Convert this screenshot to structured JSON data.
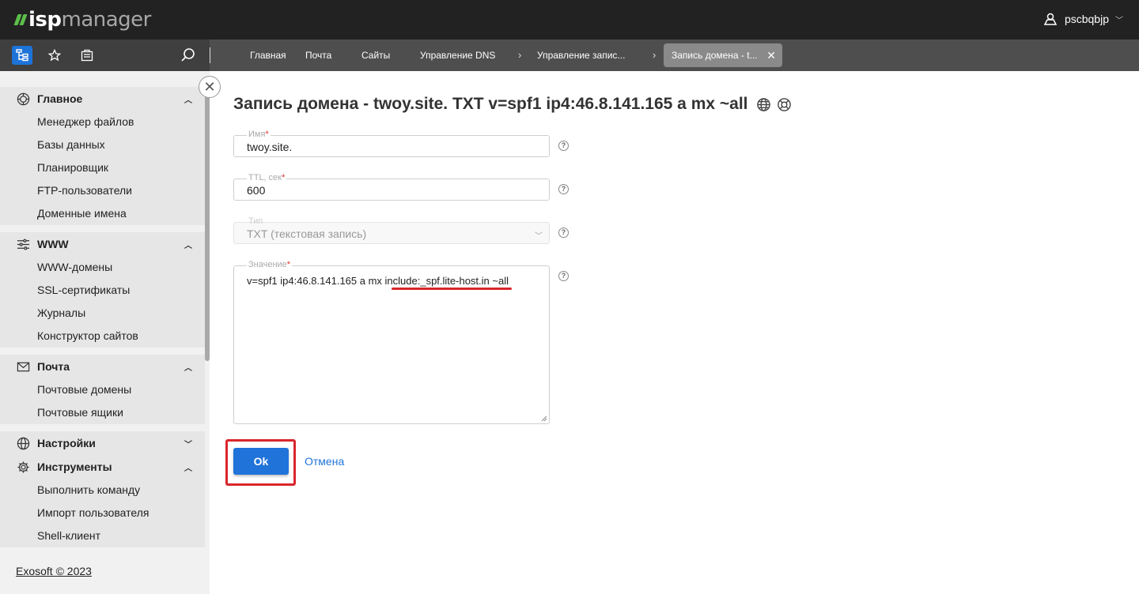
{
  "app": {
    "logo_part1": "isp",
    "logo_part2": "manager",
    "username": "pscbqbjp"
  },
  "tabs": [
    {
      "label": "Главная"
    },
    {
      "label": "Почта"
    },
    {
      "label": "Сайты"
    },
    {
      "label": "Управление DNS"
    },
    {
      "label": "Управление запис..."
    },
    {
      "label": "Запись домена - t..."
    }
  ],
  "sidebar": {
    "groups": [
      {
        "title": "Главное",
        "icon": "globe-icon",
        "expanded": true,
        "items": [
          "Менеджер файлов",
          "Базы данных",
          "Планировщик",
          "FTP-пользователи",
          "Доменные имена"
        ]
      },
      {
        "title": "WWW",
        "icon": "sliders-icon",
        "expanded": true,
        "items": [
          "WWW-домены",
          "SSL-сертификаты",
          "Журналы",
          "Конструктор сайтов"
        ]
      },
      {
        "title": "Почта",
        "icon": "envelope-icon",
        "expanded": true,
        "items": [
          "Почтовые домены",
          "Почтовые ящики"
        ]
      },
      {
        "title": "Настройки",
        "icon": "settings-globe-icon",
        "expanded": false,
        "items": []
      },
      {
        "title": "Инструменты",
        "icon": "gear-icon",
        "expanded": true,
        "items": [
          "Выполнить команду",
          "Импорт пользователя",
          "Shell-клиент"
        ]
      }
    ],
    "footer": "Exosoft © 2023"
  },
  "page": {
    "title": "Запись домена - twoy.site. TXT v=spf1 ip4:46.8.141.165 a mx ~all"
  },
  "form": {
    "name": {
      "label": "Имя",
      "required": "*",
      "value": "twoy.site."
    },
    "ttl": {
      "label": "TTL, сек",
      "required": "*",
      "value": "600"
    },
    "type": {
      "label": "Тип",
      "value": "TXT (текстовая запись)"
    },
    "value": {
      "label": "Значение",
      "required": "*",
      "value": "v=spf1 ip4:46.8.141.165 a mx include:_spf.lite-host.in ~all"
    },
    "help": "?",
    "ok_label": "Ok",
    "cancel_label": "Отмена"
  },
  "colors": {
    "accent": "#1f73d9",
    "highlight": "#d9262c",
    "topbar": "#222222",
    "logo_green": "#5cbf4a"
  }
}
